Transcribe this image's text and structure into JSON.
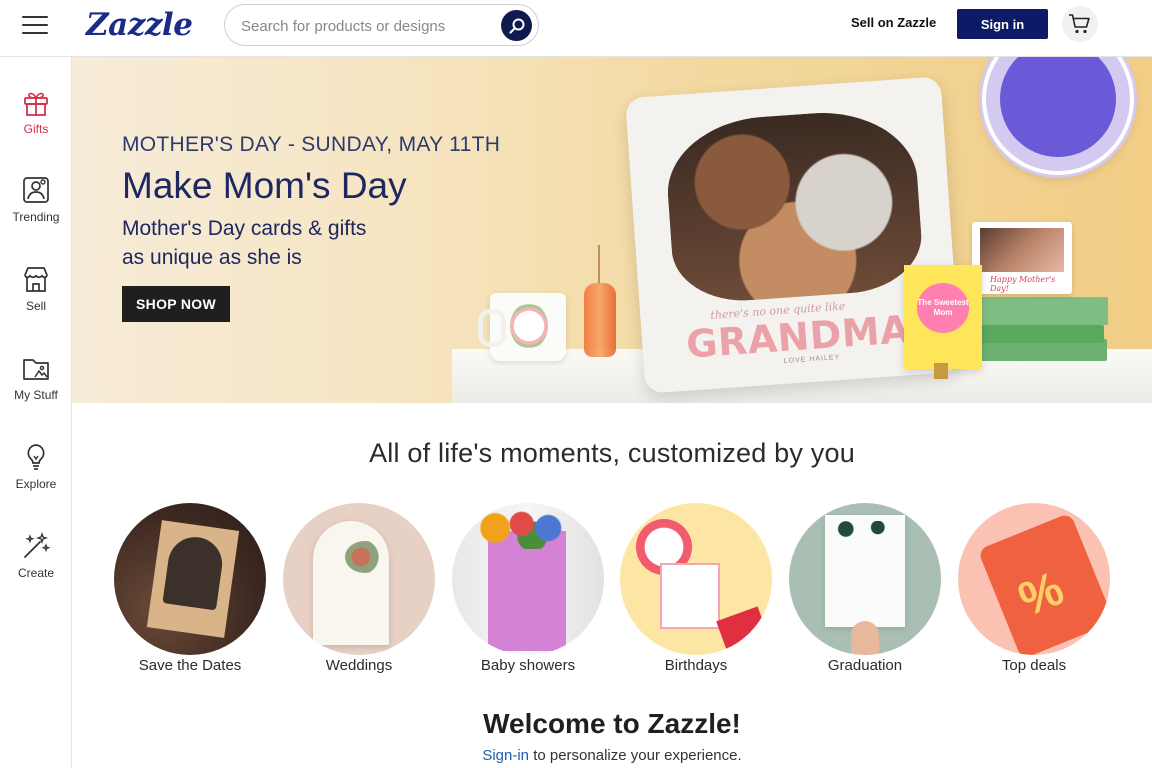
{
  "header": {
    "logo_text": "Zazzle",
    "search_placeholder": "Search for products or designs",
    "sell_link": "Sell on Zazzle",
    "signin_button": "Sign in",
    "accent_color": "#0d1a66"
  },
  "sidebar": {
    "items": [
      {
        "label": "Gifts",
        "icon": "gift-icon",
        "active": true
      },
      {
        "label": "Trending",
        "icon": "trending-icon",
        "active": false
      },
      {
        "label": "Sell",
        "icon": "storefront-icon",
        "active": false
      },
      {
        "label": "My Stuff",
        "icon": "folder-icon",
        "active": false
      },
      {
        "label": "Explore",
        "icon": "lightbulb-icon",
        "active": false
      },
      {
        "label": "Create",
        "icon": "magic-wand-icon",
        "active": false
      }
    ],
    "active_color": "#d62f4a"
  },
  "hero": {
    "kicker": "MOTHER'S DAY - SUNDAY, MAY 11TH",
    "title": "Make Mom's Day",
    "subtitle_line1": "Mother's Day cards & gifts",
    "subtitle_line2": "as unique as she is",
    "cta": "SHOP NOW",
    "pillow_script": "there's no one quite like",
    "pillow_word": "GRANDMA",
    "pillow_sign": "LOVE HAILEY",
    "card_text": "The Sweetest Mom",
    "frame_text": "Happy Mother's Day!"
  },
  "moments": {
    "title": "All of life's moments, customized by you",
    "items": [
      {
        "label": "Save the Dates"
      },
      {
        "label": "Weddings"
      },
      {
        "label": "Baby showers"
      },
      {
        "label": "Birthdays"
      },
      {
        "label": "Graduation"
      },
      {
        "label": "Top deals"
      }
    ]
  },
  "welcome": {
    "title": "Welcome to Zazzle!",
    "signin_link": "Sign-in",
    "rest_text": " to personalize your experience."
  }
}
